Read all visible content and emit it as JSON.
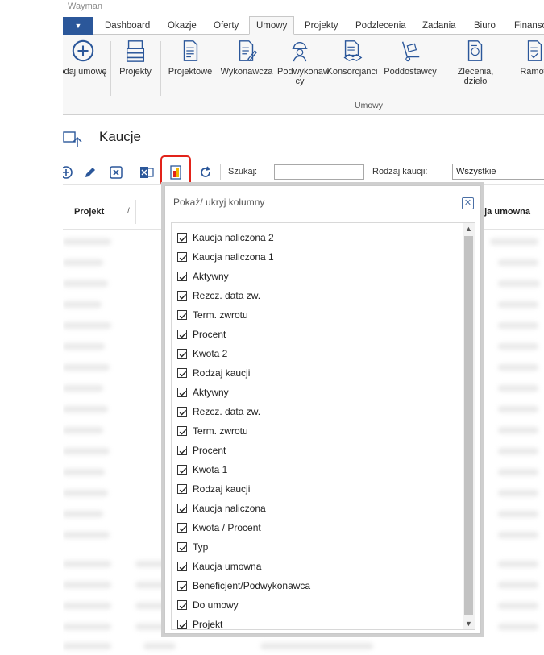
{
  "app_title": "Wayman",
  "tabs": [
    "Dashboard",
    "Okazje",
    "Oferty",
    "Umowy",
    "Projekty",
    "Podzlecenia",
    "Zadania",
    "Biuro",
    "Finanso"
  ],
  "active_tab": "Umowy",
  "ribbon": {
    "add_label": "odaj umowę",
    "projekty": "Projekty",
    "projektowe": "Projektowe",
    "wykonawcza": "Wykonawcza",
    "podwykonawcy": "Podwykonaw cy",
    "konsorcjanci": "Konsorcjanci",
    "poddostawcy": "Poddostawcy",
    "zlecenia": "Zlecenia, dzieło",
    "ramowe": "Ramow",
    "group_label": "Umowy"
  },
  "page": {
    "title": "Kaucje"
  },
  "toolbar": {
    "search_label": "Szukaj:",
    "search_value": "",
    "type_label": "Rodzaj kaucji:",
    "type_value": "Wszystkie"
  },
  "grid": {
    "col_projekt": "Projekt",
    "sort_mark": "/",
    "col_right": "cja umowna"
  },
  "popup": {
    "title": "Pokaż/ ukryj kolumny",
    "items": [
      "Kaucja naliczona 2",
      "Kaucja naliczona 1",
      "Aktywny",
      "Rezcz. data zw.",
      "Term. zwrotu",
      "Procent",
      "Kwota 2",
      "Rodzaj kaucji",
      "Aktywny",
      "Rezcz. data zw.",
      "Term. zwrotu",
      "Procent",
      "Kwota 1",
      "Rodzaj kaucji",
      "Kaucja naliczona",
      "Kwota / Procent",
      "Typ",
      "Kaucja umowna",
      "Beneficjent/Podwykonawca",
      "Do umowy",
      "Projekt"
    ]
  },
  "colors": {
    "accent": "#2b579a",
    "highlight": "#e2231a"
  }
}
